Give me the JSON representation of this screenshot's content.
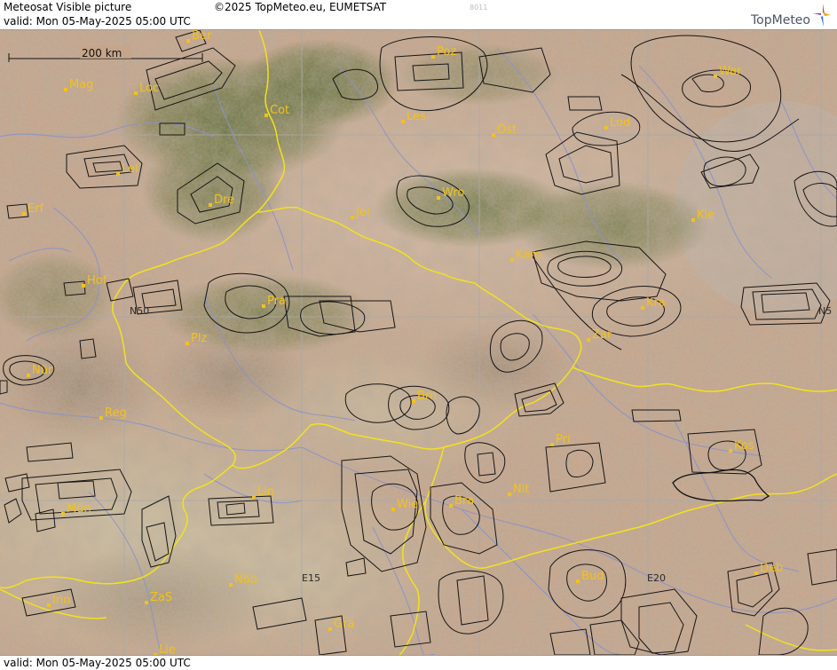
{
  "header": {
    "title": "Meteosat Visible picture",
    "valid": "valid:  Mon  05-May-2025  05:00 UTC",
    "copyright": "©2025 TopMeteo.eu, EUMETSAT",
    "code": "8011",
    "logo_text": "TopMeteo"
  },
  "footer": {
    "valid": "valid:  Mon  05-May-2025  05:00 UTC"
  },
  "scale": {
    "label": "200 km"
  },
  "grid_labels": {
    "n50_left": "N50",
    "n50_right": "N5",
    "e15": "E15",
    "e20": "E20"
  },
  "cities": [
    {
      "name": "Ber"
    },
    {
      "name": "Poz"
    },
    {
      "name": "War"
    },
    {
      "name": "Mag"
    },
    {
      "name": "Loc"
    },
    {
      "name": "Cot"
    },
    {
      "name": "Les"
    },
    {
      "name": "Lod"
    },
    {
      "name": "Ost"
    },
    {
      "name": "Lei"
    },
    {
      "name": "Dre"
    },
    {
      "name": "Wro"
    },
    {
      "name": "Erf"
    },
    {
      "name": "Jel"
    },
    {
      "name": "Kie"
    },
    {
      "name": "Kam"
    },
    {
      "name": "Hof"
    },
    {
      "name": "Pra"
    },
    {
      "name": "Kra"
    },
    {
      "name": "Zar"
    },
    {
      "name": "Plz"
    },
    {
      "name": "Nür"
    },
    {
      "name": "Brn"
    },
    {
      "name": "Reg"
    },
    {
      "name": "Pri"
    },
    {
      "name": "Kos"
    },
    {
      "name": "Nit"
    },
    {
      "name": "Lin"
    },
    {
      "name": "Mün"
    },
    {
      "name": "Wie"
    },
    {
      "name": "Bra"
    },
    {
      "name": "Nöb"
    },
    {
      "name": "Bud"
    },
    {
      "name": "Deb"
    },
    {
      "name": "ZaS"
    },
    {
      "name": "Inn"
    },
    {
      "name": "Gra"
    },
    {
      "name": "Lie"
    }
  ],
  "colors": {
    "city_label": "#f2c21b",
    "border_yellow": "#f2e21b",
    "rivers": "#8c93c8",
    "grid": "#a9a9a9",
    "terrain_tan": "#c9a487",
    "terrain_green": "#5f6c2e"
  }
}
